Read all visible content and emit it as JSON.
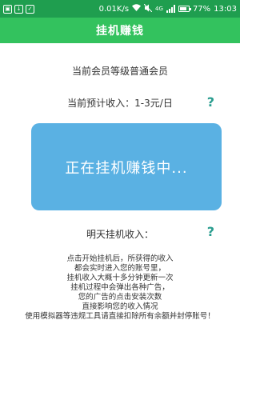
{
  "status_bar": {
    "speed": "0.01K/s",
    "network": "4G",
    "battery_pct": "77%",
    "battery_level": 0.77,
    "time": "13:03",
    "icons": [
      "image-icon",
      "download-icon",
      "check-icon",
      "wifi-icon",
      "mute-icon",
      "signal-icon",
      "battery-icon"
    ]
  },
  "header": {
    "title": "挂机赚钱"
  },
  "info": {
    "member_level": "当前会员等级普通会员",
    "estimated_income": "当前预计收入：1-3元/日",
    "help_symbol": "?",
    "status_text": "正在挂机赚钱中...",
    "tomorrow_income": "明天挂机收入："
  },
  "notes": [
    "点击开始挂机后，所获得的收入",
    "都会实时进入您的账号里，",
    "挂机收入大概十多分钟更新一次",
    "挂机过程中会弹出各种广告，",
    "您的广告的点击安装次数",
    "直接影响您的收入情况",
    "使用模拟器等违规工具请直接扣除所有余额并封停账号！"
  ],
  "colors": {
    "status_bar": "#1f9e4f",
    "header": "#33c25e",
    "status_box": "#5ab1e3",
    "help_icon": "#2a9d8f"
  }
}
